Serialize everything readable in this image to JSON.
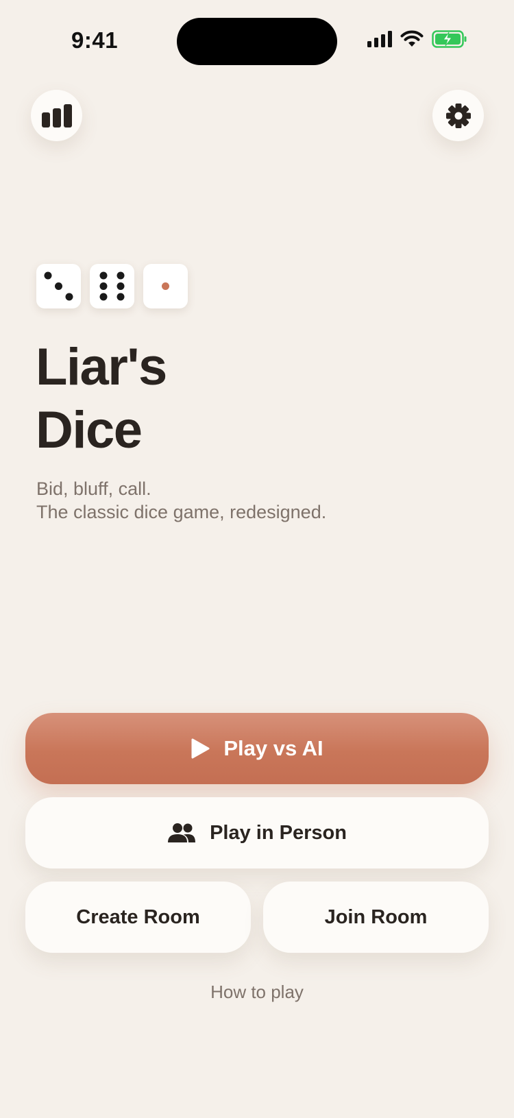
{
  "status_bar": {
    "time": "9:41"
  },
  "header": {
    "stats_icon": "bar-chart-icon",
    "settings_icon": "gear-icon"
  },
  "hero": {
    "dice": [
      {
        "face": 3,
        "pip_color": "#1a1a1a"
      },
      {
        "face": 6,
        "pip_color": "#1a1a1a"
      },
      {
        "face": 1,
        "pip_color": "#c97659"
      }
    ],
    "title_line1": "Liar's",
    "title_line2": "Dice",
    "subtitle_line1": "Bid, bluff, call.",
    "subtitle_line2": "The classic dice game, redesigned."
  },
  "actions": {
    "play_ai_label": "Play vs AI",
    "play_ai_icon": "play-icon",
    "play_person_label": "Play in Person",
    "play_person_icon": "people-icon",
    "create_room_label": "Create Room",
    "join_room_label": "Join Room",
    "how_to_play_label": "How to play"
  },
  "colors": {
    "background": "#f5f0ea",
    "accent": "#c97659",
    "text": "#2a2420",
    "muted": "#7e726a",
    "battery": "#34c759"
  }
}
